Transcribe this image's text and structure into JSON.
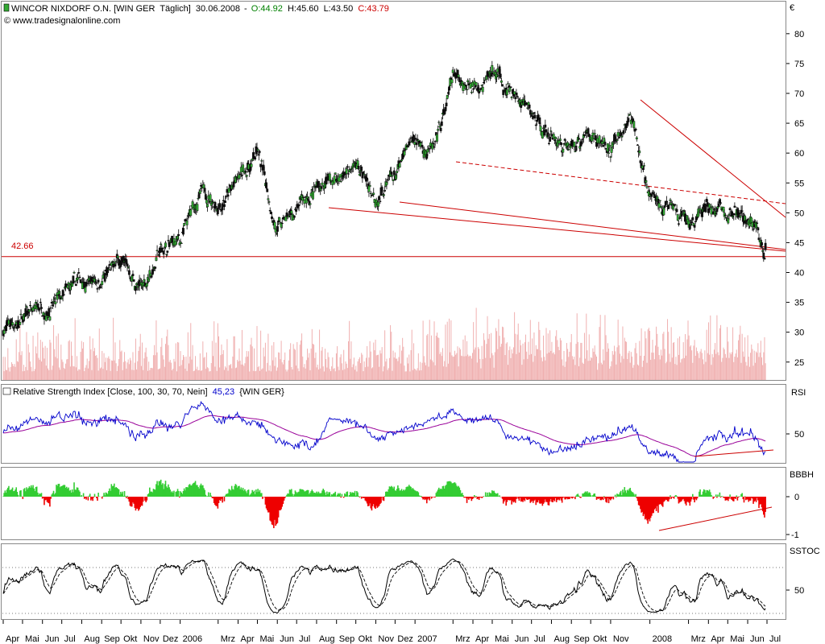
{
  "header": {
    "symbol": "WINCOR NIXDORF O.N. [WIN GER",
    "period": "Täglich]",
    "date": "30.06.2008",
    "open_label": "O:44.92",
    "high_label": "H:45.60",
    "low_label": "L:43.50",
    "close_label": "C:43.79",
    "copyright": "© www.tradesignalonline.com",
    "currency": "€"
  },
  "colors": {
    "up": "#33aa33",
    "down": "#111111",
    "line_red": "#cc0000",
    "rsi_line": "#0000cc",
    "rsi_ma": "#990099",
    "bbbh_pos": "#33cc33",
    "bbbh_neg": "#ee0000",
    "volume": "#f0b0b0"
  },
  "panels": {
    "rsi": {
      "title": "Relative Strength Index [Close, 100, 30, 70, Nein]",
      "value": "45,23",
      "symbol": "{WIN GER}",
      "label": "RSI",
      "tick_50": "50"
    },
    "bbbh": {
      "label": "BBBH",
      "tick_0": "0",
      "tick_neg1": "-1"
    },
    "sstoc": {
      "label": "SSTOC",
      "tick_50": "50"
    }
  },
  "chart_data": [
    {
      "type": "candlestick",
      "title": "WINCOR NIXDORF O.N. [WIN GER Täglich] 30.06.2008",
      "ylabel": "€",
      "yticks": [
        25,
        30,
        35,
        40,
        45,
        50,
        55,
        60,
        65,
        70,
        75,
        80
      ],
      "ylim": [
        22,
        83
      ],
      "grid": false,
      "support_level": {
        "label": "42.66",
        "value": 42.66
      },
      "x_labels": [
        "Apr",
        "Mai",
        "Jun",
        "Jul",
        "Aug",
        "Sep",
        "Okt",
        "Nov",
        "Dez",
        "2006",
        "Mrz",
        "Apr",
        "Mai",
        "Jun",
        "Jul",
        "Aug",
        "Sep",
        "Okt",
        "Nov",
        "Dez",
        "2007",
        "Mrz",
        "Apr",
        "Mai",
        "Jun",
        "Jul",
        "Aug",
        "Sep",
        "Okt",
        "Nov",
        "2008",
        "Mrz",
        "Apr",
        "Mai",
        "Jun",
        "Jul"
      ],
      "close_path": [
        {
          "x": "2005-04",
          "y": 30.5
        },
        {
          "x": "2005-05",
          "y": 32
        },
        {
          "x": "2005-06",
          "y": 34.5
        },
        {
          "x": "2005-07",
          "y": 35
        },
        {
          "x": "2005-08",
          "y": 38.5
        },
        {
          "x": "2005-09",
          "y": 39
        },
        {
          "x": "2005-10",
          "y": 41.5
        },
        {
          "x": "2005-11",
          "y": 37
        },
        {
          "x": "2005-12",
          "y": 43.5
        },
        {
          "x": "2006-01",
          "y": 45
        },
        {
          "x": "2006-02",
          "y": 53
        },
        {
          "x": "2006-03",
          "y": 52
        },
        {
          "x": "2006-04",
          "y": 55
        },
        {
          "x": "2006-05",
          "y": 60
        },
        {
          "x": "2006-06",
          "y": 47
        },
        {
          "x": "2006-07",
          "y": 50
        },
        {
          "x": "2006-08",
          "y": 54
        },
        {
          "x": "2006-09",
          "y": 56
        },
        {
          "x": "2006-10",
          "y": 58
        },
        {
          "x": "2006-11",
          "y": 53
        },
        {
          "x": "2006-12",
          "y": 56
        },
        {
          "x": "2007-01",
          "y": 62
        },
        {
          "x": "2007-02",
          "y": 60
        },
        {
          "x": "2007-03",
          "y": 72
        },
        {
          "x": "2007-04",
          "y": 72
        },
        {
          "x": "2007-05",
          "y": 74
        },
        {
          "x": "2007-06",
          "y": 70
        },
        {
          "x": "2007-07",
          "y": 66
        },
        {
          "x": "2007-08",
          "y": 63
        },
        {
          "x": "2007-09",
          "y": 61
        },
        {
          "x": "2007-10",
          "y": 64
        },
        {
          "x": "2007-11",
          "y": 60
        },
        {
          "x": "2007-12",
          "y": 66
        },
        {
          "x": "2008-01",
          "y": 52
        },
        {
          "x": "2008-02",
          "y": 51
        },
        {
          "x": "2008-03",
          "y": 47
        },
        {
          "x": "2008-04",
          "y": 51
        },
        {
          "x": "2008-05",
          "y": 50
        },
        {
          "x": "2008-06-15",
          "y": 47
        },
        {
          "x": "2008-06-30",
          "y": 43.79
        }
      ],
      "last_bar": {
        "date": "30.06.2008",
        "open": 44.92,
        "high": 45.6,
        "low": 43.5,
        "close": 43.79
      }
    },
    {
      "type": "line",
      "title": "Relative Strength Index [Close, 100, 30, 70, Nein] 45,23 {WIN GER}",
      "yticks": [
        50
      ],
      "series": [
        {
          "name": "RSI",
          "last_value": 45.23
        }
      ]
    },
    {
      "type": "bar",
      "yticks": [
        0,
        -1
      ],
      "label": "BBBH"
    },
    {
      "type": "line",
      "yticks": [
        50
      ],
      "label": "SSTOC"
    }
  ]
}
